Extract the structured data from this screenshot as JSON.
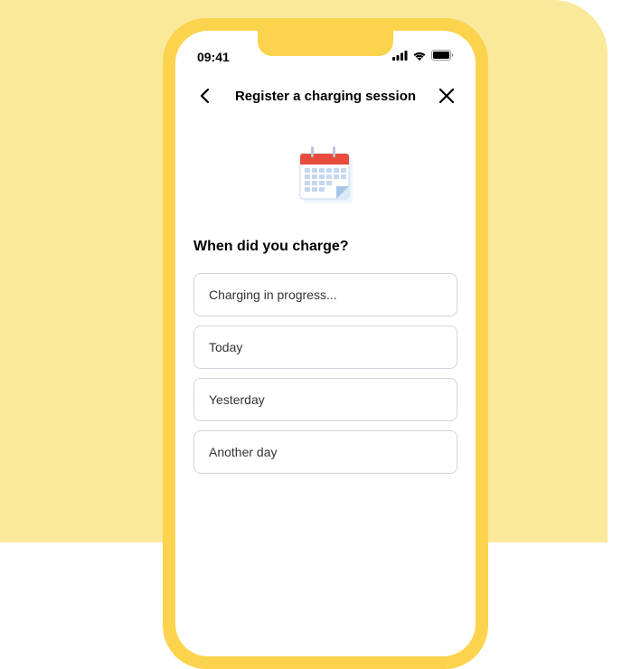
{
  "statusBar": {
    "time": "09:41"
  },
  "header": {
    "title": "Register a charging session"
  },
  "question": "When did you charge?",
  "options": [
    {
      "label": "Charging in progress..."
    },
    {
      "label": "Today"
    },
    {
      "label": "Yesterday"
    },
    {
      "label": "Another day"
    }
  ],
  "icons": {
    "calendar": "calendar-icon",
    "back": "chevron-left-icon",
    "close": "close-icon",
    "signal": "signal-icon",
    "wifi": "wifi-icon",
    "battery": "battery-icon"
  }
}
